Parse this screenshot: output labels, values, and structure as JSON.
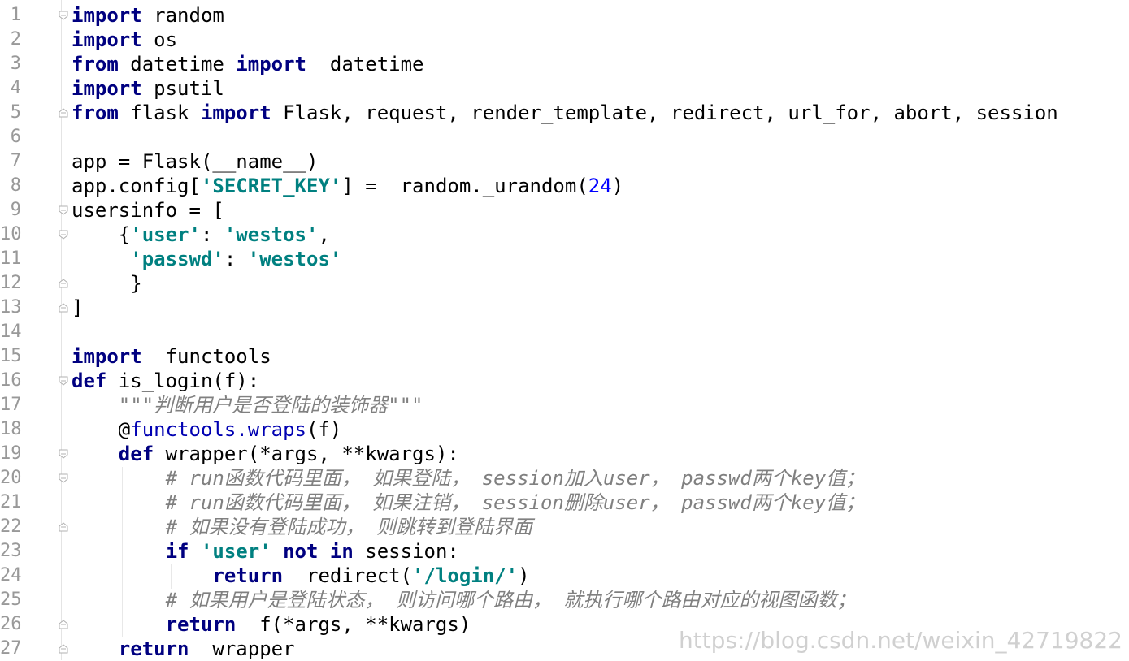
{
  "editor": {
    "lines": [
      {
        "n": "1",
        "fold": "open",
        "tokens": [
          {
            "t": "import",
            "c": "kw"
          },
          {
            "t": " random",
            "c": "plain"
          }
        ]
      },
      {
        "n": "2",
        "fold": "",
        "tokens": [
          {
            "t": "import",
            "c": "kw"
          },
          {
            "t": " os",
            "c": "plain"
          }
        ]
      },
      {
        "n": "3",
        "fold": "",
        "tokens": [
          {
            "t": "from",
            "c": "kw"
          },
          {
            "t": " datetime ",
            "c": "plain"
          },
          {
            "t": "import",
            "c": "kw"
          },
          {
            "t": "  datetime",
            "c": "plain"
          }
        ]
      },
      {
        "n": "4",
        "fold": "",
        "tokens": [
          {
            "t": "import",
            "c": "kw"
          },
          {
            "t": " psutil",
            "c": "plain"
          }
        ]
      },
      {
        "n": "5",
        "fold": "close",
        "tokens": [
          {
            "t": "from",
            "c": "kw"
          },
          {
            "t": " flask ",
            "c": "plain"
          },
          {
            "t": "import",
            "c": "kw"
          },
          {
            "t": " Flask, request, render_template, redirect, url_for, abort, session",
            "c": "plain"
          }
        ]
      },
      {
        "n": "6",
        "fold": "",
        "tokens": []
      },
      {
        "n": "7",
        "fold": "",
        "tokens": [
          {
            "t": "app = Flask(__name__)",
            "c": "plain"
          }
        ]
      },
      {
        "n": "8",
        "fold": "",
        "tokens": [
          {
            "t": "app.config[",
            "c": "plain"
          },
          {
            "t": "'SECRET_KEY'",
            "c": "str"
          },
          {
            "t": "] =  random._urandom(",
            "c": "plain"
          },
          {
            "t": "24",
            "c": "num"
          },
          {
            "t": ")",
            "c": "plain"
          }
        ]
      },
      {
        "n": "9",
        "fold": "open",
        "tokens": [
          {
            "t": "usersinfo = [",
            "c": "plain"
          }
        ]
      },
      {
        "n": "10",
        "fold": "open",
        "tokens": [
          {
            "t": "    {",
            "c": "plain"
          },
          {
            "t": "'user'",
            "c": "str"
          },
          {
            "t": ": ",
            "c": "plain"
          },
          {
            "t": "'westos'",
            "c": "str"
          },
          {
            "t": ",",
            "c": "plain"
          }
        ]
      },
      {
        "n": "11",
        "fold": "",
        "tokens": [
          {
            "t": "     ",
            "c": "plain"
          },
          {
            "t": "'passwd'",
            "c": "str"
          },
          {
            "t": ": ",
            "c": "plain"
          },
          {
            "t": "'westos'",
            "c": "str"
          }
        ]
      },
      {
        "n": "12",
        "fold": "close",
        "tokens": [
          {
            "t": "     }",
            "c": "plain"
          }
        ]
      },
      {
        "n": "13",
        "fold": "close",
        "tokens": [
          {
            "t": "]",
            "c": "plain"
          }
        ]
      },
      {
        "n": "14",
        "fold": "",
        "tokens": []
      },
      {
        "n": "15",
        "fold": "",
        "tokens": [
          {
            "t": "import",
            "c": "kw"
          },
          {
            "t": "  functools",
            "c": "plain"
          }
        ]
      },
      {
        "n": "16",
        "fold": "open",
        "tokens": [
          {
            "t": "def",
            "c": "kw"
          },
          {
            "t": " is_login(f):",
            "c": "plain"
          }
        ]
      },
      {
        "n": "17",
        "fold": "",
        "tokens": [
          {
            "t": "    ",
            "c": "plain"
          },
          {
            "t": "\"\"\"判断用户是否登陆的装饰器\"\"\"",
            "c": "cm"
          }
        ]
      },
      {
        "n": "18",
        "fold": "",
        "tokens": [
          {
            "t": "    @",
            "c": "plain"
          },
          {
            "t": "functools.wraps",
            "c": "dec"
          },
          {
            "t": "(f)",
            "c": "plain"
          }
        ]
      },
      {
        "n": "19",
        "fold": "open",
        "tokens": [
          {
            "t": "    ",
            "c": "plain"
          },
          {
            "t": "def",
            "c": "kw"
          },
          {
            "t": " wrapper(*args, **kwargs):",
            "c": "plain"
          }
        ]
      },
      {
        "n": "20",
        "fold": "open",
        "tokens": [
          {
            "t": "        ",
            "c": "plain"
          },
          {
            "t": "# run函数代码里面， 如果登陆， session加入user， passwd两个key值；",
            "c": "cm"
          }
        ]
      },
      {
        "n": "21",
        "fold": "",
        "tokens": [
          {
            "t": "        ",
            "c": "plain"
          },
          {
            "t": "# run函数代码里面， 如果注销， session删除user， passwd两个key值；",
            "c": "cm"
          }
        ]
      },
      {
        "n": "22",
        "fold": "close",
        "tokens": [
          {
            "t": "        ",
            "c": "plain"
          },
          {
            "t": "# 如果没有登陆成功， 则跳转到登陆界面",
            "c": "cm"
          }
        ]
      },
      {
        "n": "23",
        "fold": "",
        "tokens": [
          {
            "t": "        ",
            "c": "plain"
          },
          {
            "t": "if",
            "c": "kw"
          },
          {
            "t": " ",
            "c": "plain"
          },
          {
            "t": "'user'",
            "c": "str"
          },
          {
            "t": " ",
            "c": "plain"
          },
          {
            "t": "not in",
            "c": "kw"
          },
          {
            "t": " session:",
            "c": "plain"
          }
        ]
      },
      {
        "n": "24",
        "fold": "",
        "tokens": [
          {
            "t": "            ",
            "c": "plain"
          },
          {
            "t": "return",
            "c": "kw"
          },
          {
            "t": "  redirect(",
            "c": "plain"
          },
          {
            "t": "'/login/'",
            "c": "str"
          },
          {
            "t": ")",
            "c": "plain"
          }
        ]
      },
      {
        "n": "25",
        "fold": "",
        "tokens": [
          {
            "t": "        ",
            "c": "plain"
          },
          {
            "t": "# 如果用户是登陆状态， 则访问哪个路由， 就执行哪个路由对应的视图函数；",
            "c": "cm"
          }
        ]
      },
      {
        "n": "26",
        "fold": "close",
        "tokens": [
          {
            "t": "        ",
            "c": "plain"
          },
          {
            "t": "return",
            "c": "kw"
          },
          {
            "t": "  f(*args, **kwargs)",
            "c": "plain"
          }
        ]
      },
      {
        "n": "27",
        "fold": "close",
        "tokens": [
          {
            "t": "    ",
            "c": "plain"
          },
          {
            "t": "return",
            "c": "kw"
          },
          {
            "t": "  wrapper",
            "c": "plain"
          }
        ]
      }
    ]
  },
  "watermark": "https://blog.csdn.net/weixin_42719822"
}
